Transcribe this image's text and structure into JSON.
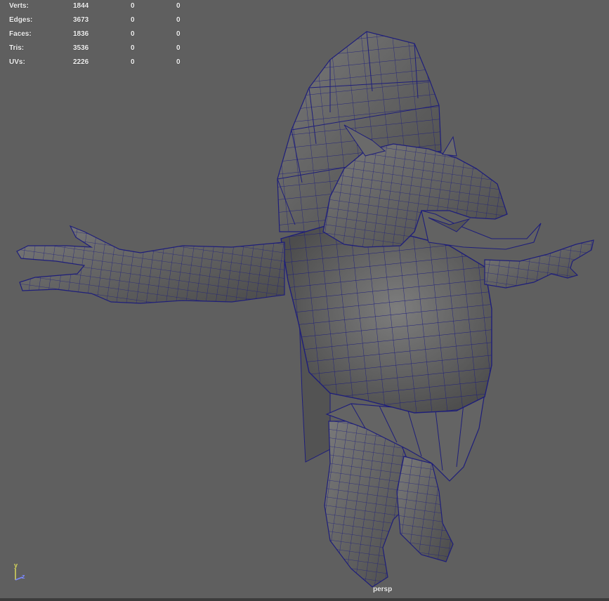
{
  "hud": {
    "rows": [
      {
        "label": "Verts:",
        "value": "1844",
        "sel1": "0",
        "sel2": "0"
      },
      {
        "label": "Edges:",
        "value": "3673",
        "sel1": "0",
        "sel2": "0"
      },
      {
        "label": "Faces:",
        "value": "1836",
        "sel1": "0",
        "sel2": "0"
      },
      {
        "label": "Tris:",
        "value": "3536",
        "sel1": "0",
        "sel2": "0"
      },
      {
        "label": "UVs:",
        "value": "2226",
        "sel1": "0",
        "sel2": "0"
      }
    ]
  },
  "viewport": {
    "camera": "persp",
    "axis_y": "y",
    "axis_z": "z"
  },
  "colors": {
    "background": "#5f5f5f",
    "mesh_fill": "#6b6b6b",
    "wireframe": "#1e1e7a",
    "hud_text": "#f2f2f2"
  }
}
